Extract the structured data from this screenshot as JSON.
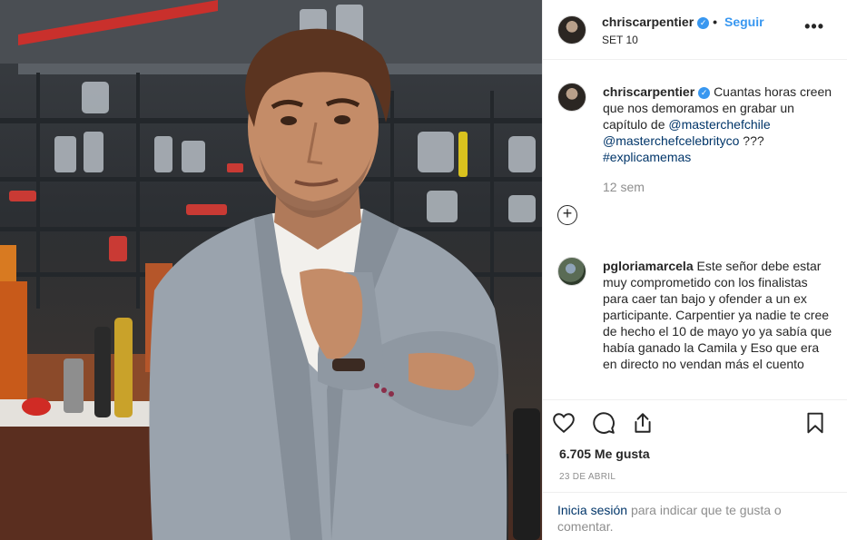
{
  "post": {
    "author": "chriscarpentier",
    "verified_icon": "verified-badge-icon",
    "dot": "•",
    "follow_label": "Seguir",
    "header_date": "SET 10",
    "more_icon": "more-options-icon"
  },
  "caption": {
    "author": "chriscarpentier",
    "text_before": "Cuantas horas creen que nos demoramos en grabar un capítulo de",
    "mention1": "@masterchefchile",
    "mention2": "@masterchefcelebrityco",
    "text_after": "???",
    "hashtag": "#explicamemas",
    "time_ago": "12 sem"
  },
  "comment": {
    "author": "pgloriamarcela",
    "text": "Este señor debe estar muy comprometido con los finalistas para caer tan bajo y ofender a un ex participante. Carpentier ya nadie te cree de hecho el 10 de mayo yo ya sabía que había ganado la Camila y Eso que era en directo no vendan más el cuento"
  },
  "actions": {
    "like_icon": "heart-icon",
    "comment_icon": "comment-bubble-icon",
    "share_icon": "share-icon",
    "save_icon": "bookmark-icon",
    "likes": "6.705 Me gusta",
    "date": "23 DE ABRIL"
  },
  "login": {
    "link": "Inicia sesión",
    "text": "para indicar que te gusta o comentar."
  },
  "colors": {
    "accent": "#3897f0",
    "link": "#003569",
    "muted": "#8e8e8e",
    "text": "#262626"
  }
}
